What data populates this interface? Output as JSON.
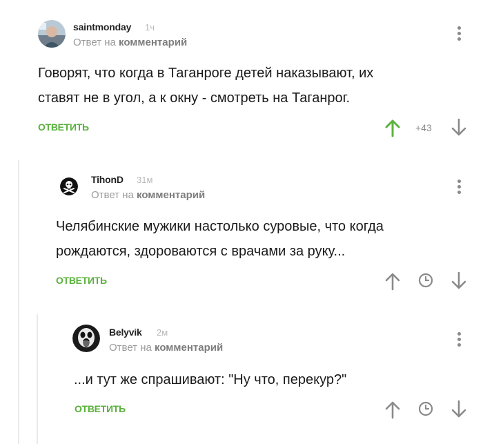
{
  "comments": [
    {
      "username": "saintmonday",
      "time": "1ч",
      "reply_prefix": "Ответ на",
      "reply_target": "комментарий",
      "text_lines": [
        "Говорят, что когда в Таганроге детей наказывают, их",
        "ставят не в угол, а к окну - смотреть на Таганрог."
      ],
      "reply_label": "ОТВЕТИТЬ",
      "rating": "+43",
      "upvote_color": "#5bb33f"
    },
    {
      "username": "TihonD",
      "time": "31м",
      "reply_prefix": "Ответ на",
      "reply_target": "комментарий",
      "text_lines": [
        "Челябинские мужики настолько суровые, что когда",
        "рождаются, здороваются с врачами за руку..."
      ],
      "reply_label": "ОТВЕТИТЬ"
    },
    {
      "username": "Belyvik",
      "time": "2м",
      "reply_prefix": "Ответ на",
      "reply_target": "комментарий",
      "text_lines": [
        "...и тут же спрашивают: \"Ну что, перекур?\""
      ],
      "reply_label": "ОТВЕТИТЬ"
    }
  ],
  "icons": {
    "upvote": "arrow-up-icon",
    "downvote": "arrow-down-icon",
    "clock": "clock-icon",
    "more": "more-vertical-icon"
  },
  "colors": {
    "accent_green": "#58b13b",
    "muted_gray": "#8a8a8a",
    "thread_line": "#e9e9e9"
  }
}
